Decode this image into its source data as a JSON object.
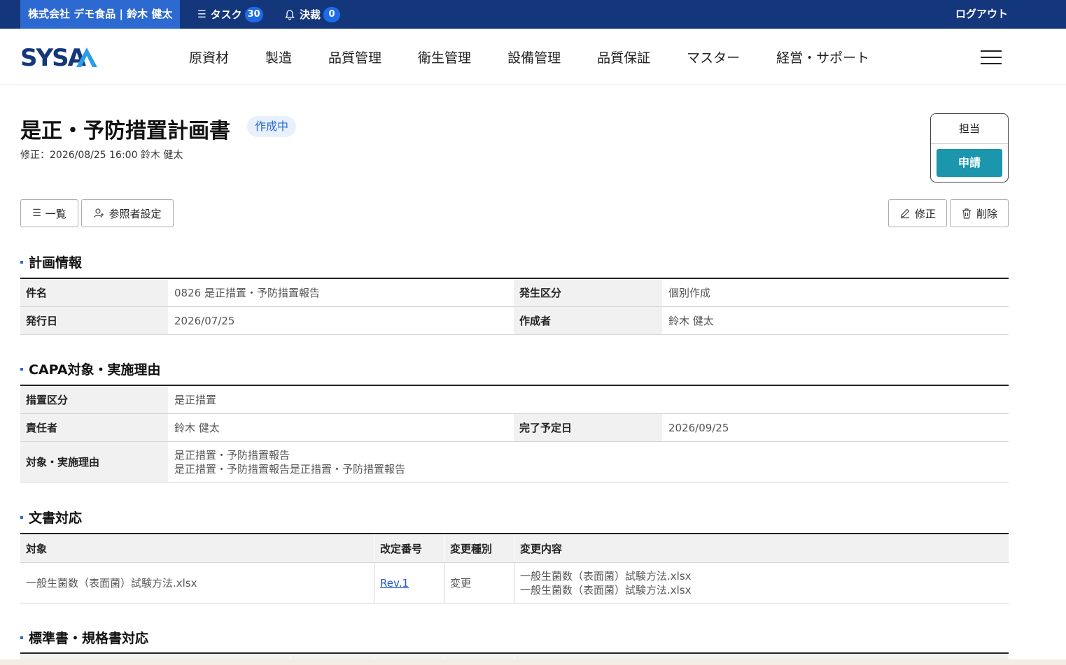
{
  "topbar": {
    "company_user": "株式会社 デモ食品 | 鈴木 健太",
    "task_label": "タスク",
    "task_count": "30",
    "approval_label": "決裁",
    "approval_count": "0",
    "logout": "ログアウト"
  },
  "brand": {
    "logo_text": "SYSA",
    "colors": {
      "navy": "#14377c",
      "accent": "#2c6ad1",
      "teal": "#1b96ad"
    }
  },
  "nav": [
    "原資材",
    "製造",
    "品質管理",
    "衛生管理",
    "設備管理",
    "品質保証",
    "マスター",
    "経営・サポート"
  ],
  "page": {
    "title": "是正・予防措置計画書",
    "status": "作成中",
    "modified": "修正：2026/08/25 16:00  鈴木 健太"
  },
  "approval": {
    "role": "担当",
    "apply": "申請"
  },
  "buttons": {
    "list": "一覧",
    "viewer_settings": "参照者設定",
    "edit": "修正",
    "delete": "削除"
  },
  "plan_info": {
    "section_title": "計画情報",
    "subject_label": "件名",
    "subject": "0826 是正措置・予防措置報告",
    "origin_label": "発生区分",
    "origin": "個別作成",
    "issue_date_label": "発行日",
    "issue_date": "2026/07/25",
    "author_label": "作成者",
    "author": "鈴木 健太"
  },
  "capa": {
    "section_title": "CAPA対象・実施理由",
    "type_label": "措置区分",
    "type": "是正措置",
    "owner_label": "責任者",
    "owner": "鈴木 健太",
    "due_label": "完了予定日",
    "due": "2026/09/25",
    "reason_label": "対象・実施理由",
    "reason_line1": "是正措置・予防措置報告",
    "reason_line2": "是正措置・予防措置報告是正措置・予防措置報告"
  },
  "documents": {
    "section_title": "文書対応",
    "headers": [
      "対象",
      "改定番号",
      "変更種別",
      "変更内容"
    ],
    "rows": [
      {
        "target": "一般生菌数（表面菌）試験方法.xlsx",
        "revision": "Rev.1",
        "change_type": "変更",
        "change_line1": "一般生菌数（表面菌）試験方法.xlsx",
        "change_line2": "一般生菌数（表面菌）試験方法.xlsx"
      }
    ]
  },
  "standards": {
    "section_title": "標準書・規格書対応"
  }
}
